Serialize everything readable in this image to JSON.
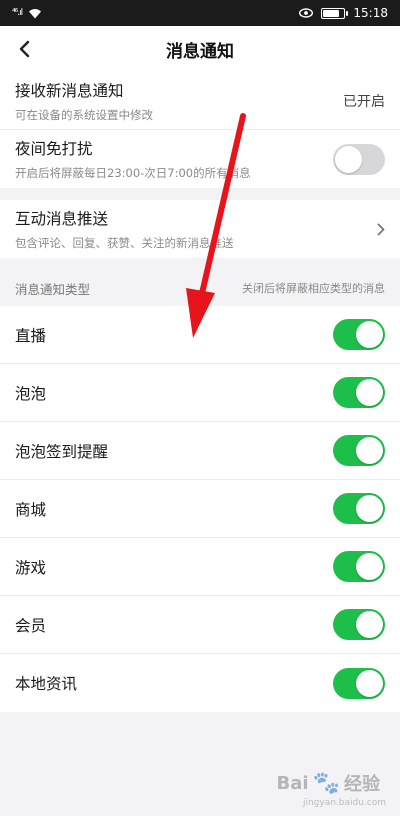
{
  "status_bar": {
    "signal": "⁴⁶.ıl",
    "wifi_icon": "wifi-icon",
    "eye_icon": "eye-icon",
    "time": "15:18",
    "battery_level": 0.85
  },
  "header": {
    "back_icon": "chevron-left-icon",
    "title": "消息通知"
  },
  "settings": {
    "receive": {
      "title": "接收新消息通知",
      "subtitle": "可在设备的系统设置中修改",
      "value": "已开启"
    },
    "dnd": {
      "title": "夜间免打扰",
      "subtitle": "开启后将屏蔽每日23:00-次日7:00的所有消息",
      "enabled": false
    },
    "interactive": {
      "title": "互动消息推送",
      "subtitle": "包含评论、回复、获赞、关注的新消息推送"
    }
  },
  "types_section": {
    "title": "消息通知类型",
    "note": "关闭后将屏蔽相应类型的消息",
    "items": [
      {
        "label": "直播",
        "enabled": true
      },
      {
        "label": "泡泡",
        "enabled": true
      },
      {
        "label": "泡泡签到提醒",
        "enabled": true
      },
      {
        "label": "商城",
        "enabled": true
      },
      {
        "label": "游戏",
        "enabled": true
      },
      {
        "label": "会员",
        "enabled": true
      },
      {
        "label": "本地资讯",
        "enabled": true
      }
    ]
  },
  "colors": {
    "toggle_on": "#1dbf4a",
    "toggle_off": "#d7d7d9",
    "arrow": "#e8141b"
  },
  "watermark": {
    "text": "Bai",
    "text2": "经验",
    "sub": "jingyan.baidu.com"
  }
}
